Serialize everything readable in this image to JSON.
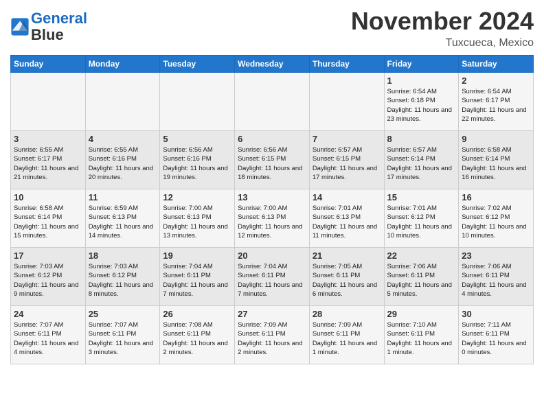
{
  "header": {
    "logo_line1": "General",
    "logo_line2": "Blue",
    "month": "November 2024",
    "location": "Tuxcueca, Mexico"
  },
  "days_of_week": [
    "Sunday",
    "Monday",
    "Tuesday",
    "Wednesday",
    "Thursday",
    "Friday",
    "Saturday"
  ],
  "weeks": [
    [
      {
        "day": "",
        "info": ""
      },
      {
        "day": "",
        "info": ""
      },
      {
        "day": "",
        "info": ""
      },
      {
        "day": "",
        "info": ""
      },
      {
        "day": "",
        "info": ""
      },
      {
        "day": "1",
        "info": "Sunrise: 6:54 AM\nSunset: 6:18 PM\nDaylight: 11 hours and 23 minutes."
      },
      {
        "day": "2",
        "info": "Sunrise: 6:54 AM\nSunset: 6:17 PM\nDaylight: 11 hours and 22 minutes."
      }
    ],
    [
      {
        "day": "3",
        "info": "Sunrise: 6:55 AM\nSunset: 6:17 PM\nDaylight: 11 hours and 21 minutes."
      },
      {
        "day": "4",
        "info": "Sunrise: 6:55 AM\nSunset: 6:16 PM\nDaylight: 11 hours and 20 minutes."
      },
      {
        "day": "5",
        "info": "Sunrise: 6:56 AM\nSunset: 6:16 PM\nDaylight: 11 hours and 19 minutes."
      },
      {
        "day": "6",
        "info": "Sunrise: 6:56 AM\nSunset: 6:15 PM\nDaylight: 11 hours and 18 minutes."
      },
      {
        "day": "7",
        "info": "Sunrise: 6:57 AM\nSunset: 6:15 PM\nDaylight: 11 hours and 17 minutes."
      },
      {
        "day": "8",
        "info": "Sunrise: 6:57 AM\nSunset: 6:14 PM\nDaylight: 11 hours and 17 minutes."
      },
      {
        "day": "9",
        "info": "Sunrise: 6:58 AM\nSunset: 6:14 PM\nDaylight: 11 hours and 16 minutes."
      }
    ],
    [
      {
        "day": "10",
        "info": "Sunrise: 6:58 AM\nSunset: 6:14 PM\nDaylight: 11 hours and 15 minutes."
      },
      {
        "day": "11",
        "info": "Sunrise: 6:59 AM\nSunset: 6:13 PM\nDaylight: 11 hours and 14 minutes."
      },
      {
        "day": "12",
        "info": "Sunrise: 7:00 AM\nSunset: 6:13 PM\nDaylight: 11 hours and 13 minutes."
      },
      {
        "day": "13",
        "info": "Sunrise: 7:00 AM\nSunset: 6:13 PM\nDaylight: 11 hours and 12 minutes."
      },
      {
        "day": "14",
        "info": "Sunrise: 7:01 AM\nSunset: 6:13 PM\nDaylight: 11 hours and 11 minutes."
      },
      {
        "day": "15",
        "info": "Sunrise: 7:01 AM\nSunset: 6:12 PM\nDaylight: 11 hours and 10 minutes."
      },
      {
        "day": "16",
        "info": "Sunrise: 7:02 AM\nSunset: 6:12 PM\nDaylight: 11 hours and 10 minutes."
      }
    ],
    [
      {
        "day": "17",
        "info": "Sunrise: 7:03 AM\nSunset: 6:12 PM\nDaylight: 11 hours and 9 minutes."
      },
      {
        "day": "18",
        "info": "Sunrise: 7:03 AM\nSunset: 6:12 PM\nDaylight: 11 hours and 8 minutes."
      },
      {
        "day": "19",
        "info": "Sunrise: 7:04 AM\nSunset: 6:11 PM\nDaylight: 11 hours and 7 minutes."
      },
      {
        "day": "20",
        "info": "Sunrise: 7:04 AM\nSunset: 6:11 PM\nDaylight: 11 hours and 7 minutes."
      },
      {
        "day": "21",
        "info": "Sunrise: 7:05 AM\nSunset: 6:11 PM\nDaylight: 11 hours and 6 minutes."
      },
      {
        "day": "22",
        "info": "Sunrise: 7:06 AM\nSunset: 6:11 PM\nDaylight: 11 hours and 5 minutes."
      },
      {
        "day": "23",
        "info": "Sunrise: 7:06 AM\nSunset: 6:11 PM\nDaylight: 11 hours and 4 minutes."
      }
    ],
    [
      {
        "day": "24",
        "info": "Sunrise: 7:07 AM\nSunset: 6:11 PM\nDaylight: 11 hours and 4 minutes."
      },
      {
        "day": "25",
        "info": "Sunrise: 7:07 AM\nSunset: 6:11 PM\nDaylight: 11 hours and 3 minutes."
      },
      {
        "day": "26",
        "info": "Sunrise: 7:08 AM\nSunset: 6:11 PM\nDaylight: 11 hours and 2 minutes."
      },
      {
        "day": "27",
        "info": "Sunrise: 7:09 AM\nSunset: 6:11 PM\nDaylight: 11 hours and 2 minutes."
      },
      {
        "day": "28",
        "info": "Sunrise: 7:09 AM\nSunset: 6:11 PM\nDaylight: 11 hours and 1 minute."
      },
      {
        "day": "29",
        "info": "Sunrise: 7:10 AM\nSunset: 6:11 PM\nDaylight: 11 hours and 1 minute."
      },
      {
        "day": "30",
        "info": "Sunrise: 7:11 AM\nSunset: 6:11 PM\nDaylight: 11 hours and 0 minutes."
      }
    ]
  ]
}
